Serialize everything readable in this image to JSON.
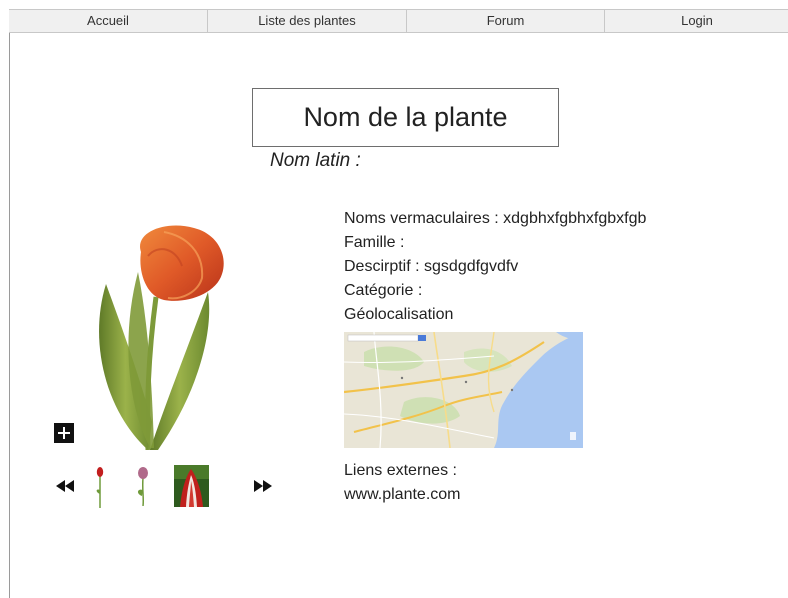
{
  "nav": {
    "items": [
      {
        "label": "Accueil"
      },
      {
        "label": "Liste des plantes"
      },
      {
        "label": "Forum"
      },
      {
        "label": "Login"
      }
    ]
  },
  "plant": {
    "name": "Nom de la plante",
    "latin_label": "Nom latin :",
    "vernacular": "Noms vermaculaires : xdgbhxfgbhxfgbxfgb",
    "family": "Famille :",
    "description": "Descirptif : sgsdgdfgvdfv",
    "category": "Catégorie :",
    "geolocation": "Géolocalisation",
    "links_label": "Liens externes :",
    "link_url": "www.plante.com"
  },
  "gallery": {
    "add_icon": "plus-icon",
    "prev_icon": "rewind-icon",
    "next_icon": "fast-forward-icon",
    "thumbnail_count": 3
  },
  "colors": {
    "nav_bg": "#f0f0f0",
    "nav_border": "#c8c8c8",
    "title_border": "#6e6e6e",
    "map_sea": "#aac8f2",
    "map_land": "#e8e4d4",
    "tulip_petal": "#e05a28",
    "tulip_leaf": "#7a9a3a"
  }
}
